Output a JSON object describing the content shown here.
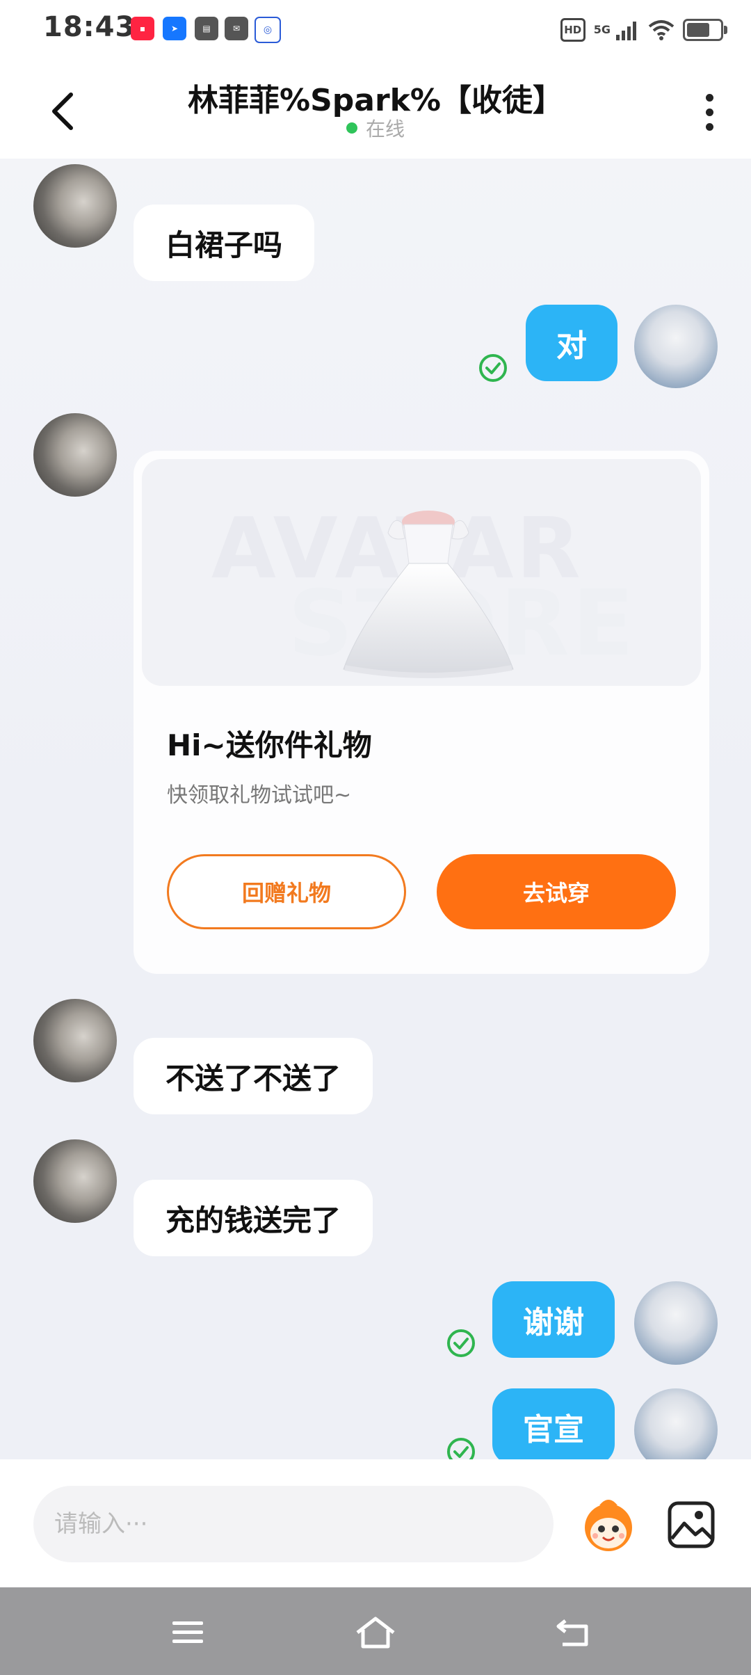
{
  "status_bar": {
    "time": "18:43",
    "app_icons": [
      "xiaohongshu-icon",
      "location-icon",
      "wallet-icon",
      "mail-icon",
      "baidu-icon"
    ],
    "hd_label": "HD",
    "network_label": "5G"
  },
  "header": {
    "title": "林菲菲%Spark%【收徒】",
    "status": "在线",
    "status_color": "#2fc45a"
  },
  "messages": [
    {
      "side": "in",
      "text": "白裙子吗"
    },
    {
      "side": "out",
      "text": "对",
      "read": true
    },
    {
      "side": "in",
      "type": "gift"
    },
    {
      "side": "in",
      "text": "不送了不送了"
    },
    {
      "side": "in",
      "text": "充的钱送完了"
    },
    {
      "side": "out",
      "text": "谢谢",
      "read": true
    },
    {
      "side": "out",
      "text": "官宣",
      "read": true
    }
  ],
  "gift_card": {
    "watermark_1": "AVATAR",
    "watermark_2": "STORE",
    "title": "Hi~送你件礼物",
    "subtitle": "快领取礼物试试吧~",
    "return_gift_label": "回赠礼物",
    "try_on_label": "去试穿"
  },
  "input": {
    "placeholder": "请输入···"
  },
  "colors": {
    "outgoing_bubble": "#2cb4f6",
    "accent_orange": "#ff7012",
    "read_check": "#2fb54f"
  }
}
